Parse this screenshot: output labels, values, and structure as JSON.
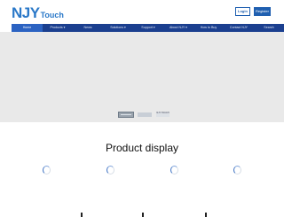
{
  "header": {
    "logo_main": "NJY",
    "logo_sub": "Touch",
    "login_label": "Login",
    "register_label": "Register"
  },
  "nav": {
    "items": [
      {
        "label": "Home",
        "active": true
      },
      {
        "label": "Products ▾",
        "active": false
      },
      {
        "label": "News",
        "active": false
      },
      {
        "label": "Solutions ▾",
        "active": false
      },
      {
        "label": "Support ▾",
        "active": false
      },
      {
        "label": "About NJY ▾",
        "active": false
      },
      {
        "label": "How to Buy",
        "active": false
      },
      {
        "label": "Contact NJY",
        "active": false
      },
      {
        "label": "Search",
        "active": false
      }
    ]
  },
  "banner": {
    "thumb_caption": "NJY TOUCH"
  },
  "main": {
    "section_title": "Product display"
  },
  "colors": {
    "brand_blue": "#2a78c8",
    "nav_bg": "#1b3f8f",
    "nav_active": "#2c63c2"
  }
}
